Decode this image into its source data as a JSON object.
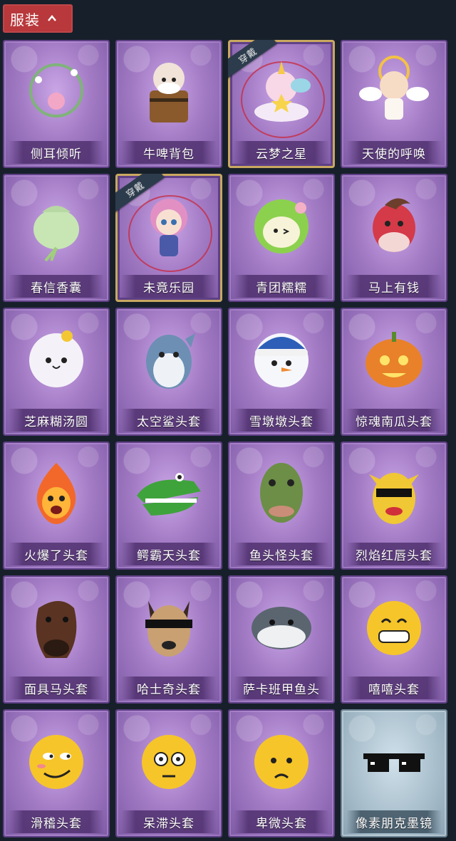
{
  "header": {
    "title": "服装"
  },
  "items": [
    {
      "label": "侧耳倾听",
      "icon": "flower-wreath-icon",
      "equipped": false
    },
    {
      "label": "牛啤背包",
      "icon": "cow-barrel-icon",
      "equipped": false
    },
    {
      "label": "云梦之星",
      "icon": "unicorn-cloud-icon",
      "equipped": true,
      "badge": "穿戴"
    },
    {
      "label": "天使的呼唤",
      "icon": "angel-icon",
      "equipped": false
    },
    {
      "label": "春信香囊",
      "icon": "sachet-icon",
      "equipped": false
    },
    {
      "label": "未竟乐园",
      "icon": "magic-girl-icon",
      "equipped": true,
      "badge": "穿戴"
    },
    {
      "label": "青团糯糯",
      "icon": "green-dumpling-icon",
      "equipped": false
    },
    {
      "label": "马上有钱",
      "icon": "red-horse-icon",
      "equipped": false
    },
    {
      "label": "芝麻糊汤圆",
      "icon": "rice-ball-icon",
      "equipped": false
    },
    {
      "label": "太空鲨头套",
      "icon": "shark-head-icon",
      "equipped": false
    },
    {
      "label": "雪墩墩头套",
      "icon": "snowman-head-icon",
      "equipped": false
    },
    {
      "label": "惊魂南瓜头套",
      "icon": "pumpkin-head-icon",
      "equipped": false
    },
    {
      "label": "火爆了头套",
      "icon": "fire-head-icon",
      "equipped": false
    },
    {
      "label": "鳄霸天头套",
      "icon": "crocodile-head-icon",
      "equipped": false
    },
    {
      "label": "鱼头怪头套",
      "icon": "fish-monster-head-icon",
      "equipped": false
    },
    {
      "label": "烈焰红唇头套",
      "icon": "yellow-mask-head-icon",
      "equipped": false
    },
    {
      "label": "面具马头套",
      "icon": "horse-mask-icon",
      "equipped": false
    },
    {
      "label": "哈士奇头套",
      "icon": "husky-head-icon",
      "equipped": false
    },
    {
      "label": "萨卡班甲鱼头",
      "icon": "fish-head-icon",
      "equipped": false
    },
    {
      "label": "嘻嘻头套",
      "icon": "grin-emoji-icon",
      "equipped": false
    },
    {
      "label": "滑稽头套",
      "icon": "smirk-emoji-icon",
      "equipped": false
    },
    {
      "label": "呆滞头套",
      "icon": "dazed-emoji-icon",
      "equipped": false
    },
    {
      "label": "卑微头套",
      "icon": "pleading-emoji-icon",
      "equipped": false
    },
    {
      "label": "像素朋克墨镜",
      "icon": "pixel-sunglasses-icon",
      "equipped": false,
      "pale": true
    }
  ],
  "colors": {
    "tab": "#b8383b",
    "card": "#a47cc6",
    "background": "#17202a",
    "selected_border": "#c9a860"
  }
}
